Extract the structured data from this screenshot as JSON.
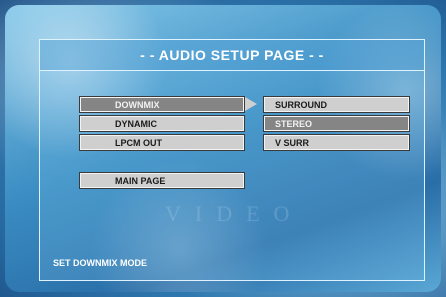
{
  "window": {
    "title": "- - AUDIO SETUP PAGE - -"
  },
  "background": {
    "watermark_text": "VIDEO"
  },
  "menu": {
    "items": [
      {
        "label": "DOWNMIX",
        "selected": true
      },
      {
        "label": "DYNAMIC",
        "selected": false
      },
      {
        "label": "LPCM OUT",
        "selected": false
      }
    ],
    "main_page_label": "MAIN PAGE"
  },
  "submenu": {
    "options": [
      {
        "label": "SURROUND",
        "selected": false
      },
      {
        "label": "STEREO",
        "selected": true
      },
      {
        "label": "V SURR",
        "selected": false
      }
    ],
    "arrow_icon": "triangle-right-icon"
  },
  "status": {
    "text": "SET DOWNMIX MODE"
  },
  "colors": {
    "selected_fill": "#858585",
    "normal_fill": "#cfcfcf",
    "text_white": "#ffffff"
  }
}
